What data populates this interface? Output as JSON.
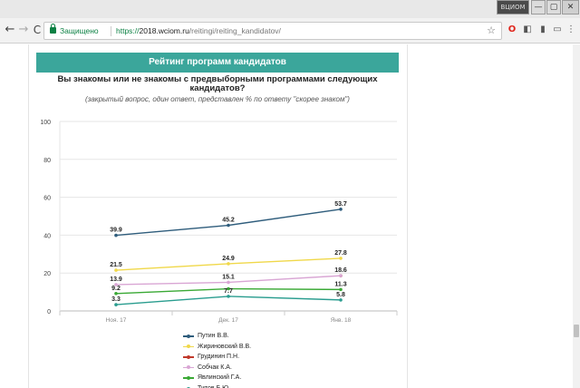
{
  "browser": {
    "window_user": "ВЦИОМ",
    "window_min": "—",
    "window_max": "▢",
    "window_close": "✕",
    "secure_label": "Защищено",
    "url_protocol": "https://",
    "url_host": "2018.wciom.ru",
    "url_path": "/reitingi/reiting_kandidatov/"
  },
  "icons": {
    "back": "←",
    "forward": "→",
    "reload": "C",
    "star": "☆",
    "opera": "O",
    "ext2": "◧",
    "ext3": "▮",
    "ext4": "▭",
    "menu": "⋮"
  },
  "header": {
    "title": "Рейтинг программ кандидатов"
  },
  "colors": {
    "header_bg": "#3ba69b",
    "putin": "#2f5d7c",
    "zhirinovsky": "#f0d84a",
    "grudinin": "#c0392b",
    "sobchak": "#d9a6d4",
    "yavlinsky": "#3aa935",
    "titov": "#2a9d8f"
  },
  "chart_data": {
    "type": "line",
    "title": "Вы знакомы или не знакомы с предвыборными программами следующих кандидатов?",
    "subtitle": "(закрытый вопрос, один ответ, представлен % по ответу \"скорее знаком\")",
    "categories": [
      "Ноя. 17",
      "Дек. 17",
      "Янв. 18"
    ],
    "ylim": [
      0,
      100
    ],
    "yticks": [
      0,
      20,
      40,
      60,
      80,
      100
    ],
    "grid": true,
    "legend_position": "bottom",
    "series": [
      {
        "name": "Путин В.В.",
        "values": [
          39.9,
          45.2,
          53.7
        ],
        "color": "#2f5d7c",
        "labels": [
          "39.9",
          "45.2",
          "53.7"
        ]
      },
      {
        "name": "Жириновский В.В.",
        "values": [
          21.5,
          24.9,
          27.8
        ],
        "color": "#f0d84a",
        "labels": [
          "21.5",
          "24.9",
          "27.8"
        ]
      },
      {
        "name": "Грудинин П.Н.",
        "values": [
          null,
          null,
          18.6
        ],
        "color": "#c0392b",
        "labels": [
          "",
          "",
          ""
        ]
      },
      {
        "name": "Собчак К.А.",
        "values": [
          13.9,
          15.1,
          18.6
        ],
        "color": "#d9a6d4",
        "labels": [
          "13.9",
          "15.1",
          "18.6"
        ]
      },
      {
        "name": "Явлинский Г.А.",
        "values": [
          9.2,
          11.7,
          11.3
        ],
        "color": "#3aa935",
        "labels": [
          "9.2",
          "",
          "11.3"
        ]
      },
      {
        "name": "Титов Б.Ю.",
        "values": [
          3.3,
          7.7,
          5.8
        ],
        "color": "#2a9d8f",
        "labels": [
          "3.3",
          "7.7",
          "5.8"
        ]
      }
    ]
  }
}
